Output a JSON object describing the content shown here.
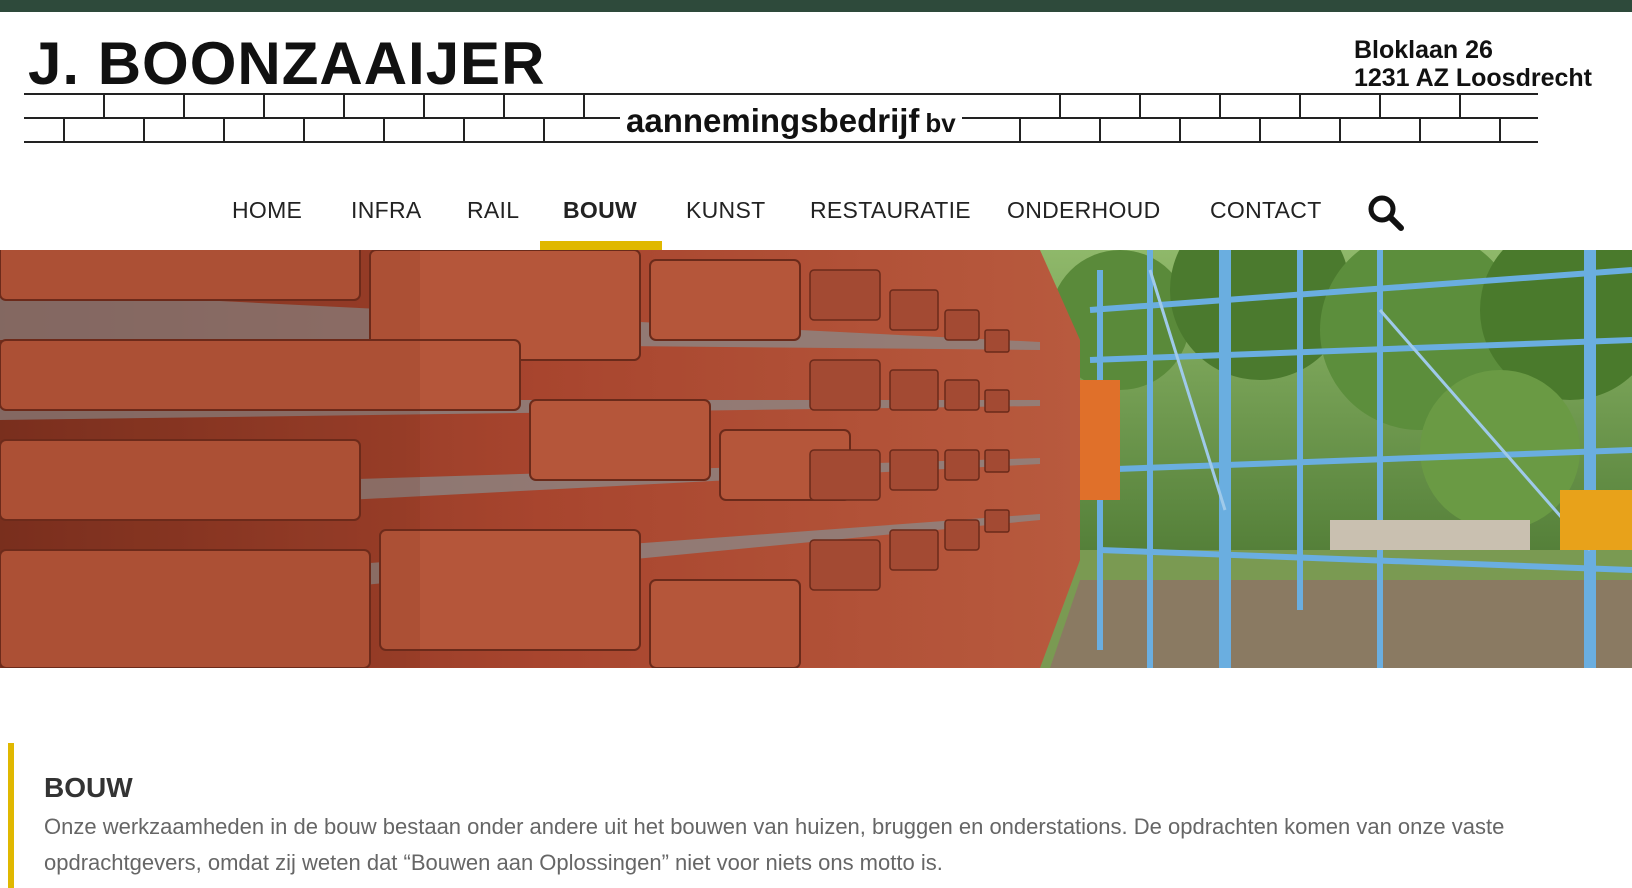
{
  "header": {
    "company_name": "J. BOONZAAIJER",
    "company_sub": "aannemingsbedrijf",
    "company_suffix": "bv",
    "address_line1": "Bloklaan 26",
    "address_line2": "1231 AZ  Loosdrecht"
  },
  "nav": {
    "items": [
      {
        "label": "HOME"
      },
      {
        "label": "INFRA"
      },
      {
        "label": "RAIL"
      },
      {
        "label": "BOUW"
      },
      {
        "label": "KUNST"
      },
      {
        "label": "RESTAURATIE"
      },
      {
        "label": "ONDERHOUD"
      },
      {
        "label": "CONTACT"
      }
    ],
    "active": "BOUW",
    "search_icon": "search-icon"
  },
  "content": {
    "title": "BOUW",
    "text": "Onze werkzaamheden in de bouw bestaan onder andere uit het bouwen van huizen, bruggen en onderstations. De opdrachten komen van onze vaste opdrachtgevers, omdat zij weten dat “Bouwen aan Oplossingen” niet voor niets ons motto is."
  },
  "colors": {
    "topbar": "#2e4a3b",
    "accent": "#e0b800",
    "brick": "#a8452e",
    "mortar": "#8a8a8a",
    "foliage": "#4f7a32",
    "scaffold": "#5a9fd6"
  }
}
